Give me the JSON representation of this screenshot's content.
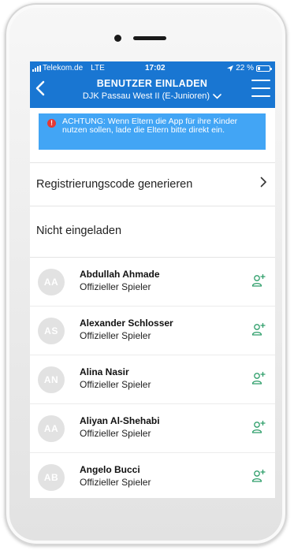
{
  "status_bar": {
    "carrier": "Telekom.de",
    "network": "LTE",
    "time": "17:02",
    "battery": "22 %",
    "battery_level": 0.22
  },
  "header": {
    "title": "BENUTZER EINLADEN",
    "subtitle": "DJK Passau West II (E-Junioren)",
    "back_icon": "chevron-left-icon",
    "menu_icon": "hamburger-menu-icon"
  },
  "banner": {
    "icon": "alert-icon",
    "icon_glyph": "!",
    "text": "ACHTUNG: Wenn Eltern die App für ihre Kinder  nutzen sollen, lade die Eltern bitte direkt ein."
  },
  "registration": {
    "label": "Registrierungscode generieren"
  },
  "not_invited": {
    "title": "Nicht eingeladen",
    "members": [
      {
        "initials": "AA",
        "name": "Abdullah Ahmade",
        "role": "Offizieller Spieler"
      },
      {
        "initials": "AS",
        "name": "Alexander Schlosser",
        "role": "Offizieller Spieler"
      },
      {
        "initials": "AN",
        "name": "Alina Nasir",
        "role": "Offizieller Spieler"
      },
      {
        "initials": "AA",
        "name": "Aliyan Al-Shehabi",
        "role": "Offizieller Spieler"
      },
      {
        "initials": "AB",
        "name": "Angelo Bucci",
        "role": "Offizieller Spieler"
      }
    ]
  },
  "colors": {
    "primary": "#1976d2",
    "banner": "#42a5f5",
    "alert": "#e53935",
    "invite": "#2e9e6a",
    "avatar": "#e2e2e2"
  }
}
